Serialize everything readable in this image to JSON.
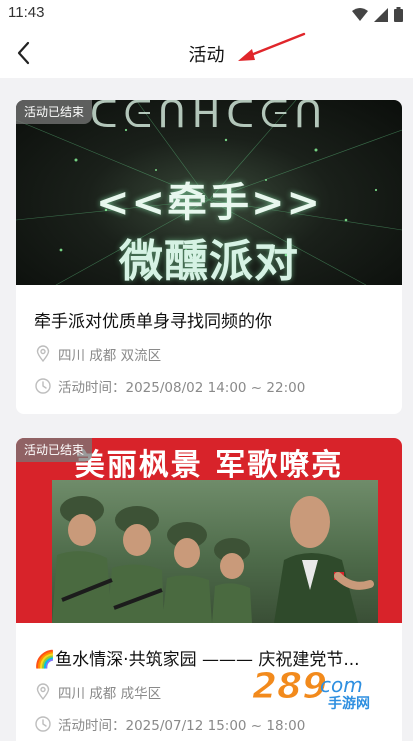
{
  "status_bar": {
    "time": "11:43"
  },
  "header": {
    "title": "活动"
  },
  "activities": [
    {
      "badge": "活动已结束",
      "cover_headline": "<<牵手>>",
      "cover_subline": "微醺派对",
      "title": "牵手派对优质单身寻找同频的你",
      "location": "四川 成都 双流区",
      "time": "活动时间：2025/08/02 14:00 ~ 22:00"
    },
    {
      "badge": "活动已结束",
      "cover_banner": "美丽枫景 军歌嘹亮",
      "title": "🌈鱼水情深·共筑家园 ——— 庆祝建党节...",
      "location": "四川 成都 成华区",
      "time": "活动时间：2025/07/12 15:00 ~ 18:00"
    }
  ],
  "watermark": {
    "text_main": "289",
    "text_sub": "手游网"
  },
  "colors": {
    "banner_red": "#d8232a",
    "badge_bg": "#8a8a8a",
    "annotation_red": "#e0262b"
  }
}
